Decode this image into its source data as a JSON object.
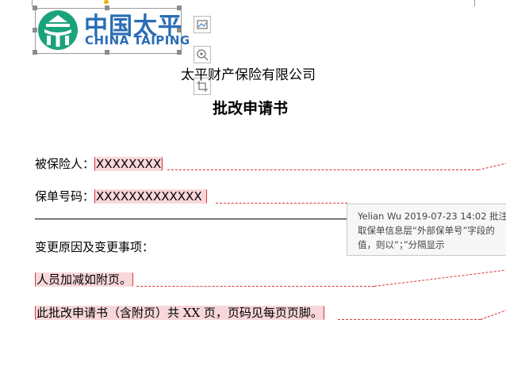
{
  "document": {
    "company_name": "太平财产保险有限公司",
    "title": "批改申请书",
    "fields": [
      {
        "label": "被保险人：",
        "value": "XXXXXXXX"
      },
      {
        "label": "保单号码：",
        "value": "XXXXXXXXXXXXX"
      }
    ],
    "change_heading": "变更原因及变更事项：",
    "change_item": "人员加减如附页。",
    "footer_text": "此批改申请书（含附页）共 XX 页，页码见每页页脚。"
  },
  "logo": {
    "cn": "中国太平",
    "en": "CHINA TAIPING",
    "primary_color": "#2a6db5",
    "mark_color": "#1aa37a"
  },
  "comment": {
    "author": "Yelian Wu",
    "datetime": "2019-07-23 14:02",
    "kind": "批注",
    "lines": [
      "取保单信息层“外部保单号”字段的",
      "值，则以“；”分隔显示"
    ]
  },
  "colors": {
    "revision": "#d33333",
    "revision_bg": "#f8d7da",
    "comment_bg": "#f7f7f7"
  }
}
